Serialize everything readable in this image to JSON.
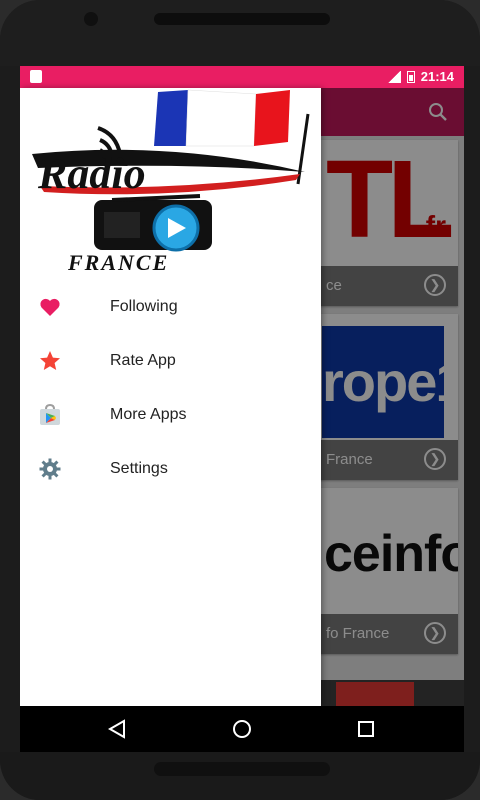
{
  "status_bar": {
    "time": "21:14"
  },
  "background": {
    "cards": [
      {
        "caption": "ce"
      },
      {
        "caption": "France",
        "art_text": "rope1"
      },
      {
        "caption": "fo France",
        "art_text": "ceinfo"
      }
    ],
    "card1_art": {
      "text": "TL",
      "suffix": ".fr"
    }
  },
  "drawer": {
    "logo": {
      "title": "Radio",
      "subtitle": "FRANCE"
    },
    "items": [
      {
        "label": "Following"
      },
      {
        "label": "Rate App"
      },
      {
        "label": "More Apps"
      },
      {
        "label": "Settings"
      }
    ]
  },
  "colors": {
    "status_bar": "#e91e63",
    "toolbar": "#c2185b",
    "heart": "#e91e63",
    "star": "#f44336"
  }
}
